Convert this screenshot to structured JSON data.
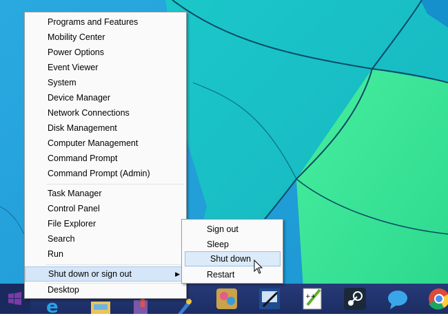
{
  "winx_menu": {
    "group1": [
      "Programs and Features",
      "Mobility Center",
      "Power Options",
      "Event Viewer",
      "System",
      "Device Manager",
      "Network Connections",
      "Disk Management",
      "Computer Management",
      "Command Prompt",
      "Command Prompt (Admin)"
    ],
    "group2": [
      "Task Manager",
      "Control Panel",
      "File Explorer",
      "Search",
      "Run"
    ],
    "shutdown_label": "Shut down or sign out",
    "shutdown_arrow": "▶",
    "desktop_label": "Desktop"
  },
  "shutdown_submenu": {
    "items": [
      "Sign out",
      "Sleep",
      "Shut down",
      "Restart"
    ]
  },
  "taskbar": {
    "icons": [
      "start-icon",
      "internet-explorer-icon",
      "file-explorer-icon",
      "paint-icon",
      "tool-icon",
      "trading-card-icon",
      "image-editor-icon",
      "notepad-plus-plus-icon",
      "steam-icon",
      "messaging-icon",
      "chrome-icon"
    ]
  },
  "colors": {
    "wallpaper_blue": "#1aa3dc",
    "wallpaper_teal": "#1fd7c2",
    "wallpaper_green": "#3fe699",
    "menu_bg": "#fafafa",
    "highlight": "#d5e6f8",
    "taskbar": "#1c2d63"
  }
}
